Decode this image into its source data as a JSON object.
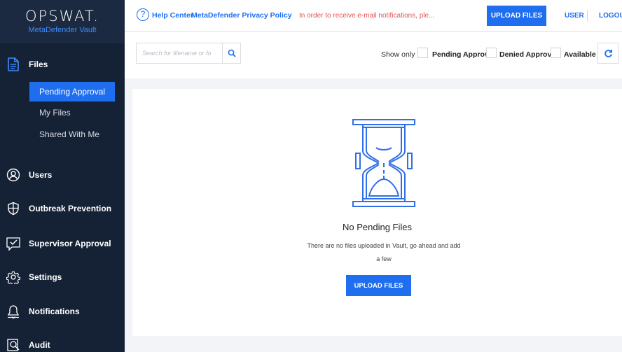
{
  "brand": {
    "name": "OPSWAT.",
    "product": "MetaDefender Vault"
  },
  "sidebar": {
    "files_label": "Files",
    "files_sub": [
      "Pending Approval",
      "My Files",
      "Shared With Me"
    ],
    "items": [
      {
        "label": "Users",
        "icon": "users-icon"
      },
      {
        "label": "Outbreak Prevention",
        "icon": "shield-icon"
      },
      {
        "label": "Supervisor Approval",
        "icon": "check-box-icon"
      },
      {
        "label": "Settings",
        "icon": "gear-icon"
      },
      {
        "label": "Notifications",
        "icon": "bell-icon"
      },
      {
        "label": "Audit",
        "icon": "audit-icon"
      }
    ]
  },
  "header": {
    "help_icon": "?",
    "help_center": "Help Center",
    "privacy_policy": "MetaDefender Privacy Policy",
    "email_notice": "In order to receive e-mail notifications, ple...",
    "upload_files": "UPLOAD FILES",
    "user": "USER",
    "logout": "LOGOUT"
  },
  "toolbar": {
    "search_placeholder": "Search for filename or fo",
    "show_only": "Show only",
    "filters": [
      "Pending Approval",
      "Denied Approval",
      "Available"
    ]
  },
  "content": {
    "title": "No Pending Files",
    "message": "There are no files uploaded in Vault, go ahead and add a few",
    "upload_button": "UPLOAD FILES"
  },
  "colors": {
    "accent": "#1f6ef0",
    "sidebar": "#152236",
    "warning": "#e65252"
  }
}
